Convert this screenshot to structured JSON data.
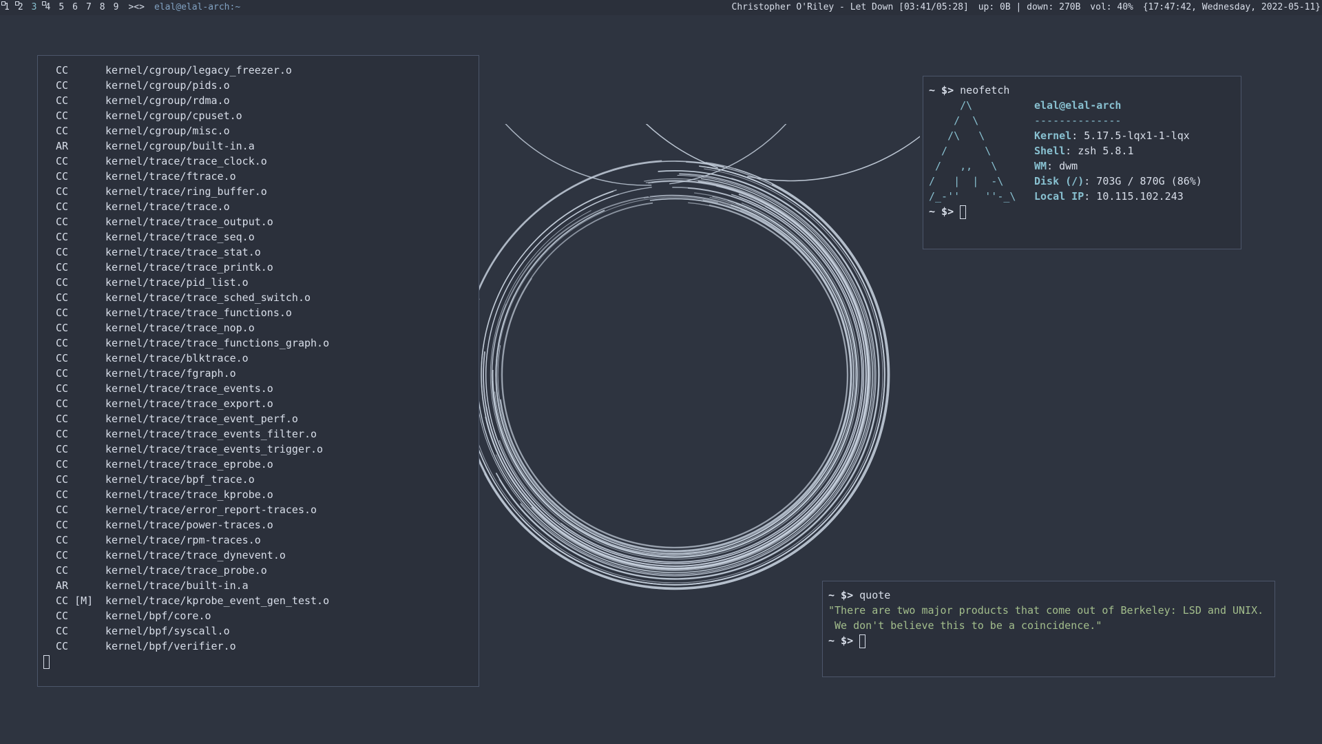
{
  "bar": {
    "tags": [
      "1",
      "2",
      "3",
      "4",
      "5",
      "6",
      "7",
      "8",
      "9"
    ],
    "active_tag": "3",
    "occupied_tags": [
      "1",
      "2",
      "4"
    ],
    "layout": "><>",
    "title": "elal@elal-arch:~",
    "now_playing": "Christopher O'Riley - Let Down [03:41/05:28]",
    "net": "up:   0B | down:  270B",
    "volume": "vol: 40%",
    "clock": "{17:47:42, Wednesday, 2022-05-11}"
  },
  "build_output": [
    [
      "CC",
      "kernel/cgroup/legacy_freezer.o"
    ],
    [
      "CC",
      "kernel/cgroup/pids.o"
    ],
    [
      "CC",
      "kernel/cgroup/rdma.o"
    ],
    [
      "CC",
      "kernel/cgroup/cpuset.o"
    ],
    [
      "CC",
      "kernel/cgroup/misc.o"
    ],
    [
      "AR",
      "kernel/cgroup/built-in.a"
    ],
    [
      "CC",
      "kernel/trace/trace_clock.o"
    ],
    [
      "CC",
      "kernel/trace/ftrace.o"
    ],
    [
      "CC",
      "kernel/trace/ring_buffer.o"
    ],
    [
      "CC",
      "kernel/trace/trace.o"
    ],
    [
      "CC",
      "kernel/trace/trace_output.o"
    ],
    [
      "CC",
      "kernel/trace/trace_seq.o"
    ],
    [
      "CC",
      "kernel/trace/trace_stat.o"
    ],
    [
      "CC",
      "kernel/trace/trace_printk.o"
    ],
    [
      "CC",
      "kernel/trace/pid_list.o"
    ],
    [
      "CC",
      "kernel/trace/trace_sched_switch.o"
    ],
    [
      "CC",
      "kernel/trace/trace_functions.o"
    ],
    [
      "CC",
      "kernel/trace/trace_nop.o"
    ],
    [
      "CC",
      "kernel/trace/trace_functions_graph.o"
    ],
    [
      "CC",
      "kernel/trace/blktrace.o"
    ],
    [
      "CC",
      "kernel/trace/fgraph.o"
    ],
    [
      "CC",
      "kernel/trace/trace_events.o"
    ],
    [
      "CC",
      "kernel/trace/trace_export.o"
    ],
    [
      "CC",
      "kernel/trace/trace_event_perf.o"
    ],
    [
      "CC",
      "kernel/trace/trace_events_filter.o"
    ],
    [
      "CC",
      "kernel/trace/trace_events_trigger.o"
    ],
    [
      "CC",
      "kernel/trace/trace_eprobe.o"
    ],
    [
      "CC",
      "kernel/trace/bpf_trace.o"
    ],
    [
      "CC",
      "kernel/trace/trace_kprobe.o"
    ],
    [
      "CC",
      "kernel/trace/error_report-traces.o"
    ],
    [
      "CC",
      "kernel/trace/power-traces.o"
    ],
    [
      "CC",
      "kernel/trace/rpm-traces.o"
    ],
    [
      "CC",
      "kernel/trace/trace_dynevent.o"
    ],
    [
      "CC",
      "kernel/trace/trace_probe.o"
    ],
    [
      "AR",
      "kernel/trace/built-in.a"
    ],
    [
      "CC [M]",
      "kernel/trace/kprobe_event_gen_test.o"
    ],
    [
      "CC",
      "kernel/bpf/core.o"
    ],
    [
      "CC",
      "kernel/bpf/syscall.o"
    ],
    [
      "CC",
      "kernel/bpf/verifier.o"
    ]
  ],
  "neofetch": {
    "prompt": "~ $>",
    "command": "neofetch",
    "art": [
      "     /\\",
      "    /  \\",
      "   /\\   \\",
      "  /      \\",
      " /   ,,   \\",
      "/   |  |  -\\",
      "/_-''    ''-_\\"
    ],
    "user": "elal@elal-arch",
    "separator": "--------------",
    "info": [
      {
        "key": "Kernel",
        "value": ": 5.17.5-lqx1-1-lqx"
      },
      {
        "key": "Shell",
        "value": ": zsh 5.8.1"
      },
      {
        "key": "WM",
        "value": ": dwm"
      },
      {
        "key": "Disk (/)",
        "value": ": 703G / 870G (86%)"
      },
      {
        "key": "Local IP",
        "value": ": 10.115.102.243"
      }
    ]
  },
  "quote_term": {
    "prompt": "~ $>",
    "command": "quote",
    "lines": [
      "\"There are two major products that come out of Berkeley: LSD and UNIX.",
      " We don't believe this to be a coincidence.\""
    ]
  },
  "colors": {
    "background": "#2e3440",
    "terminal_bg": "#2b303b",
    "accent_cyan": "#88c0d0",
    "quote_green": "#a3be8c",
    "ring": "#c5cfdc"
  }
}
